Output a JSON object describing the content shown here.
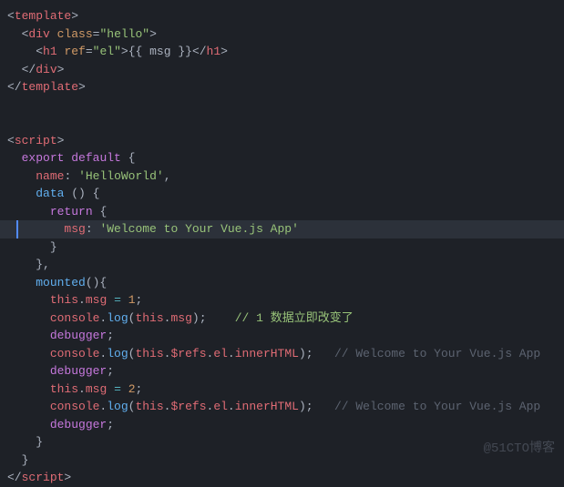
{
  "code": {
    "template": {
      "open": "template",
      "div_class": "hello",
      "h1_ref": "el",
      "mustache_var": "msg",
      "close": "template"
    },
    "script": {
      "open": "script",
      "export": "export",
      "default": "default",
      "name_key": "name",
      "name_val": "'HelloWorld'",
      "data_fn": "data",
      "return": "return",
      "msg_key": "msg",
      "msg_val": "'Welcome to Your Vue.js App'",
      "mounted": "mounted",
      "this": "this",
      "msg_prop": "msg",
      "assign1": "1",
      "assign2": "2",
      "console": "console",
      "log": "log",
      "refs": "$refs",
      "el": "el",
      "innerHTML": "innerHTML",
      "debugger": "debugger",
      "comment1": "// 1 数据立即改变了",
      "comment2": "// Welcome to Your Vue.js App",
      "comment3": "// Welcome to Your Vue.js App",
      "close": "script"
    }
  },
  "watermark": "@51CTO博客"
}
